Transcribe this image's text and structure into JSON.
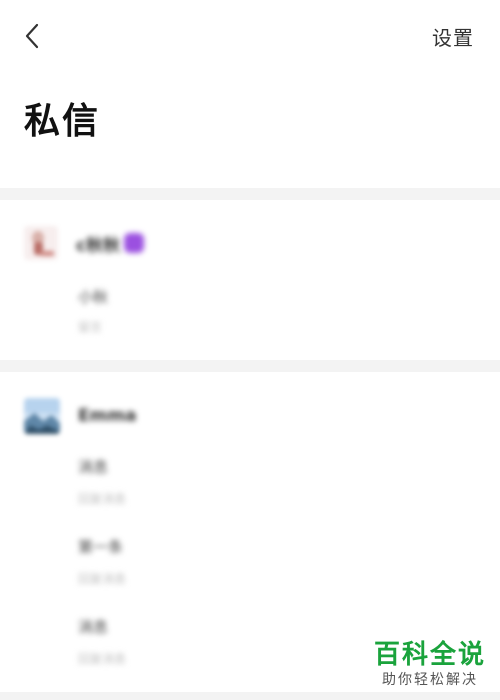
{
  "header": {
    "back_icon": "chevron-left-icon",
    "settings_label": "设置"
  },
  "title": "私信",
  "conversations": [
    {
      "name": "c秋秋",
      "avatar_icon": "person-photo-avatar",
      "badge_color": "#9b50e0",
      "messages": [
        {
          "title": "小秋",
          "sub": "留言"
        }
      ]
    },
    {
      "name": "Emma",
      "avatar_icon": "landscape-photo-avatar",
      "messages": [
        {
          "title": "消息",
          "sub": "回复消息"
        },
        {
          "title": "第一条",
          "sub": "回复消息"
        },
        {
          "title": "消息",
          "sub": "回复消息"
        }
      ]
    }
  ],
  "watermark": {
    "main": "百科全说",
    "sub": "助你轻松解决",
    "color": "#1aa33c"
  },
  "colors": {
    "separator": "#f3f3f3",
    "accent_badge": "#9b50e0"
  }
}
